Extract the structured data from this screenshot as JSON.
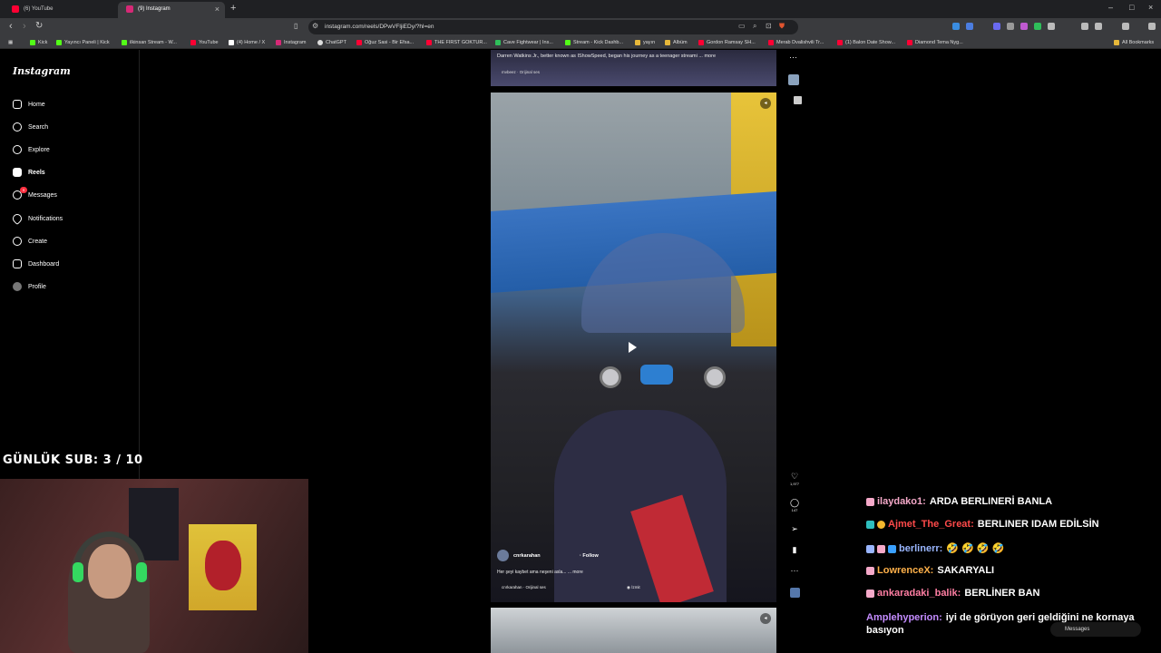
{
  "browser": {
    "tabs": [
      {
        "title": "(6) YouTube",
        "favicon_color": "#ff0033"
      },
      {
        "title": "(9) Instagram",
        "favicon_color": "#d62976"
      }
    ],
    "new_tab": "+",
    "url": "instagram.com/reels/DPwVFljiEDy/?hl=en",
    "bookmarks": [
      {
        "label": "Kick",
        "color": "#53fc18"
      },
      {
        "label": "Yayıncı Paneli | Kick",
        "color": "#53fc18"
      },
      {
        "label": "ilkinsan Stream - W...",
        "color": "#53fc18"
      },
      {
        "label": "YouTube",
        "color": "#ff0033"
      },
      {
        "label": "(4) Home / X",
        "color": "#ffffff"
      },
      {
        "label": "Instagram",
        "color": "#d62976"
      },
      {
        "label": "ChatGPT",
        "color": "#dddddd"
      },
      {
        "label": "Oğuz Sasi - Bir Efsa...",
        "color": "#ff0033"
      },
      {
        "label": "THE FIRST GOKTUR...",
        "color": "#ff0033"
      },
      {
        "label": "Cave Fightwear | Ins...",
        "color": "#2fbf5a"
      },
      {
        "label": "Stream - Kick Dashb...",
        "color": "#53fc18"
      },
      {
        "label": "yayın",
        "color": "#e7b83a"
      },
      {
        "label": "Albüm",
        "color": "#e7b83a"
      },
      {
        "label": "Gordon Ramsay SH...",
        "color": "#ff0033"
      },
      {
        "label": "Merab Dvalishvili Tr...",
        "color": "#ff0033"
      },
      {
        "label": "(1) Balon Date Show...",
        "color": "#ff0033"
      },
      {
        "label": "Diamond Tema Nyg...",
        "color": "#ff0033"
      }
    ],
    "all_bookmarks": "All Bookmarks"
  },
  "sidebar": {
    "logo": "Instagram",
    "items": [
      {
        "label": "Home",
        "icon": "home-icon"
      },
      {
        "label": "Search",
        "icon": "search-icon"
      },
      {
        "label": "Explore",
        "icon": "compass-icon"
      },
      {
        "label": "Reels",
        "icon": "reels-icon"
      },
      {
        "label": "Messages",
        "icon": "messenger-icon",
        "badge": "9"
      },
      {
        "label": "Notifications",
        "icon": "heart-icon"
      },
      {
        "label": "Create",
        "icon": "plus-icon"
      },
      {
        "label": "Dashboard",
        "icon": "chart-icon"
      },
      {
        "label": "Profile",
        "icon": "avatar"
      }
    ]
  },
  "reel_prev": {
    "caption": "Darren Watkins Jr., better known as IShowSpeed, began his journey as a teenager streami ... more",
    "audio": "mvbeez · Orijinal ses"
  },
  "reel": {
    "username": "cnrkarahan",
    "follow": "Follow",
    "description": "Her şeyi kaybet ama neşeni asla... ... more",
    "audio": "cnrkarahan · Orijinal ses",
    "location": "İzmit",
    "likes": "1,977",
    "comments": "147"
  },
  "stream": {
    "sub_counter": "GÜNLÜK SUB: 3 / 10",
    "chat": [
      {
        "user": "ilaydako1:",
        "text": "ARDA BERLINERİ BANLA",
        "color": "#f5a9c9"
      },
      {
        "user": "Ajmet_The_Great:",
        "text": "BERLINER IDAM EDİLSİN",
        "color": "#ff4a4a"
      },
      {
        "user": "berlinerr:",
        "text": "🤣 🤣 🤣 🤣",
        "color": "#9ab6ff"
      },
      {
        "user": "LowrenceX:",
        "text": "SAKARYALI",
        "color": "#ffb14a"
      },
      {
        "user": "ankaradaki_balik:",
        "text": "BERLİNER BAN",
        "color": "#ff7ea3"
      },
      {
        "user": "Amplehyperion:",
        "text": "iyi de görüyon geri geldiğini ne kornaya basıyon",
        "color": "#c48cff"
      }
    ],
    "messages_pill": "Messages"
  }
}
